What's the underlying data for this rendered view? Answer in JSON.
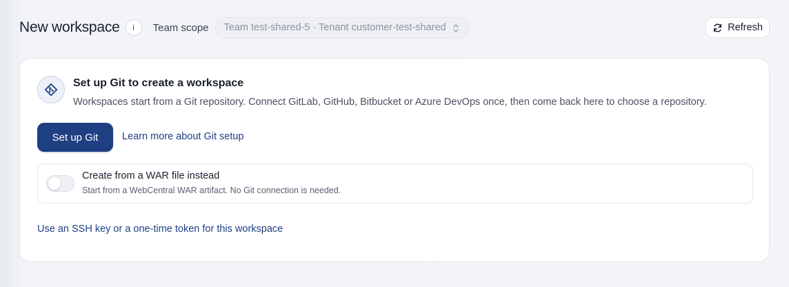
{
  "header": {
    "title": "New workspace",
    "info_glyph": "i",
    "scope_label": "Team scope",
    "scope_value": "Team test-shared-5 · Tenant customer-test-shared",
    "refresh_label": "Refresh"
  },
  "card": {
    "icon": "git-icon",
    "title": "Set up Git to create a workspace",
    "description": "Workspaces start from a Git repository. Connect GitLab, GitHub, Bitbucket or Azure DevOps once, then come back here to choose a repository.",
    "setup_button": "Set up Git",
    "learn_link": "Learn more about Git setup",
    "war_option": {
      "title": "Create from a WAR file instead",
      "subtitle": "Start from a WebCentral WAR artifact. No Git connection is needed.",
      "enabled": false
    },
    "ssh_link": "Use an SSH key or a one-time token for this workspace"
  },
  "colors": {
    "accent": "#1e3f82",
    "background": "#f3f5f9",
    "card": "#ffffff"
  }
}
